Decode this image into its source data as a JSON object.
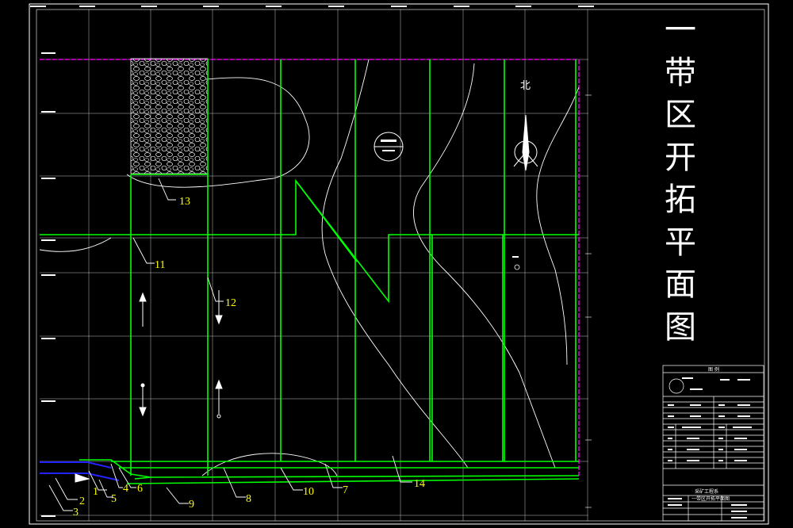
{
  "drawing": {
    "title_chars": [
      "一",
      "带",
      "区",
      "开",
      "拓",
      "平",
      "面",
      "图"
    ],
    "north_label": "北",
    "callouts": [
      "1",
      "2",
      "3",
      "4",
      "5",
      "6",
      "7",
      "8",
      "9",
      "10",
      "11",
      "12",
      "13",
      "14"
    ],
    "title_block": {
      "top_heading": "图 例",
      "company_label": "采矿工程系",
      "sheet_name": "一带区开拓平面图"
    }
  },
  "colors": {
    "background": "#000000",
    "grid": "#ffffff",
    "roadway": "#00ff00",
    "boundary": "#ff00ff",
    "contour": "#ffffff",
    "callout": "#ffff00",
    "shaft": "#0000ff"
  }
}
